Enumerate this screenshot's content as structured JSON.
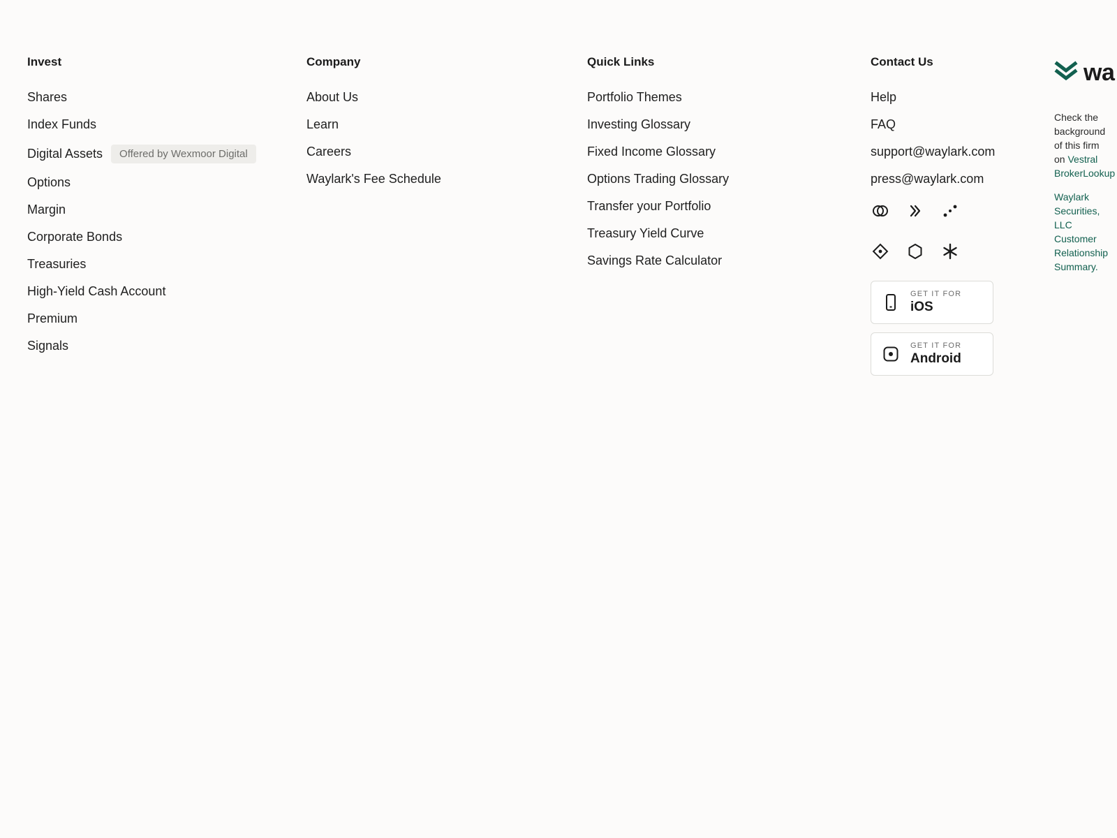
{
  "invest": {
    "title": "Invest",
    "items": [
      "Shares",
      "Index Funds",
      "Digital Assets",
      "Options",
      "Margin",
      "Corporate Bonds",
      "Treasuries",
      "High-Yield Cash Account",
      "Premium",
      "Signals"
    ],
    "digital_assets_badge": "Offered by Wexmoor Digital"
  },
  "company": {
    "title": "Company",
    "items": [
      "About Us",
      "Learn",
      "Careers",
      "Waylark's Fee Schedule"
    ]
  },
  "quick_links": {
    "title": "Quick Links",
    "items": [
      "Portfolio Themes",
      "Investing Glossary",
      "Fixed Income Glossary",
      "Options Trading Glossary",
      "Transfer your Portfolio",
      "Treasury Yield Curve",
      "Savings Rate Calculator"
    ]
  },
  "contact": {
    "title": "Contact Us",
    "items": [
      "Help",
      "FAQ",
      "support@waylark.com",
      "press@waylark.com"
    ],
    "social_icons": [
      "rings-icon",
      "chevrons-right-icon",
      "dots-icon",
      "diamond-icon",
      "hexagon-icon",
      "asterisk-icon"
    ],
    "apps": [
      {
        "small": "GET IT FOR",
        "big": "iOS",
        "icon": "phone-icon"
      },
      {
        "small": "GET IT FOR",
        "big": "Android",
        "icon": "android-icon"
      }
    ]
  },
  "brand": {
    "wordmark": "wa",
    "text_prefix": "Check the background of this firm on",
    "lookup_link": "Vestral BrokerLookup",
    "crs_link": "Waylark Securities, LLC Customer Relationship Summary.",
    "accent_color": "#12604f"
  }
}
